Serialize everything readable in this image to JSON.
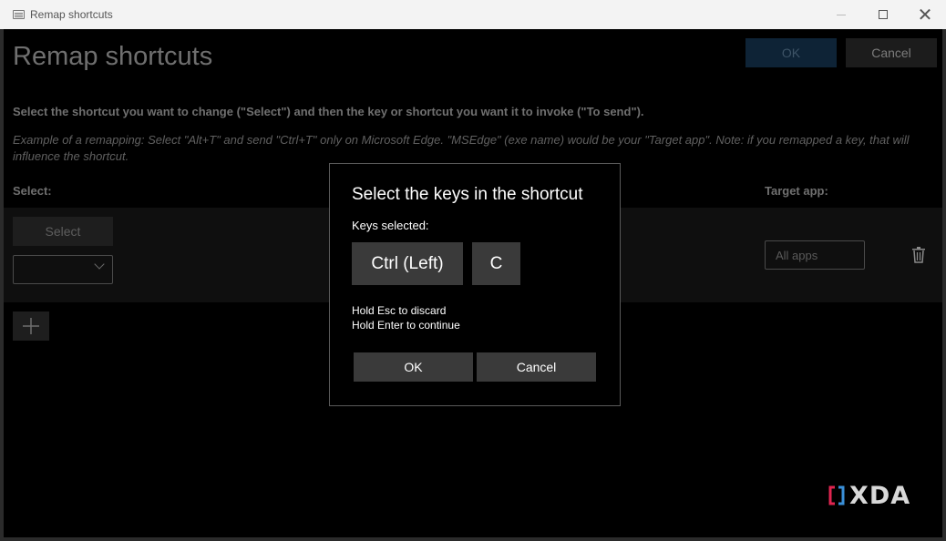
{
  "window": {
    "title": "Remap shortcuts",
    "close_glyph": "✕"
  },
  "header": {
    "title": "Remap shortcuts",
    "ok_label": "OK",
    "cancel_label": "Cancel"
  },
  "instructions": {
    "main": "Select the shortcut you want to change (\"Select\") and then the key or shortcut you want it to invoke (\"To send\").",
    "example": "Example of a remapping: Select \"Alt+T\" and send \"Ctrl+T\" only on Microsoft Edge. \"MSEdge\" (exe name) would be your \"Target app\". Note: if you remapped a key, that will influence the shortcut."
  },
  "columns": {
    "select": "Select:",
    "target_app": "Target app:"
  },
  "row": {
    "select_button": "Select",
    "dropdown_value": "",
    "target_placeholder": "All apps"
  },
  "dialog": {
    "title": "Select the keys in the shortcut",
    "keys_label": "Keys selected:",
    "keys": [
      "Ctrl (Left)",
      "C"
    ],
    "hint_discard": "Hold Esc to discard",
    "hint_continue": "Hold Enter to continue",
    "ok_label": "OK",
    "cancel_label": "Cancel"
  },
  "watermark": {
    "text": "XDA"
  },
  "colors": {
    "background": "#000000",
    "titlebar": "#f3f3f3",
    "keycap": "#3a3a3a",
    "accent_dim": "#0e2336",
    "watermark_accent": "#e02550"
  },
  "icons": [
    "keyboard-app-icon",
    "minimize-icon",
    "maximize-icon",
    "close-icon",
    "chevron-down-icon",
    "trash-icon",
    "plus-icon",
    "xda-logo-icon"
  ]
}
